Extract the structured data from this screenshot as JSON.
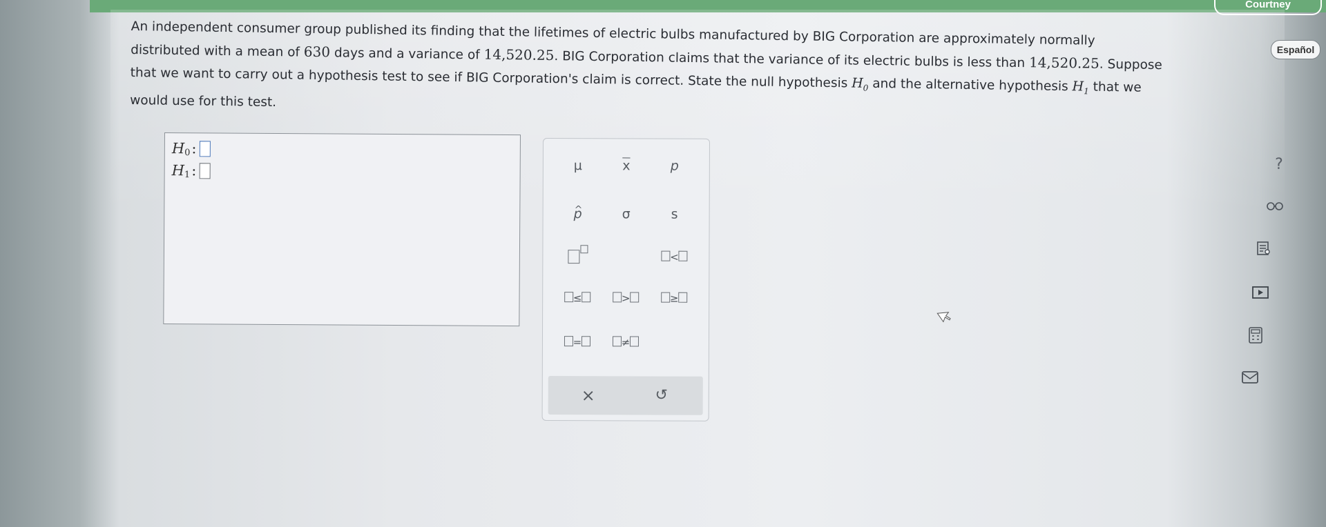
{
  "header": {
    "account_label": "Courtney",
    "language_button": "Español"
  },
  "question": {
    "line1": "An independent consumer group published its finding that the lifetimes of electric bulbs manufactured by BIG Corporation are approximately normally",
    "line2_a": "distributed with a mean of ",
    "mean": "630",
    "line2_b": " days and a variance of ",
    "variance": "14,520.25",
    "line2_c": ". BIG Corporation claims that the variance of its electric bulbs is less than ",
    "claim_variance": "14,520.25",
    "line2_d": ". Suppose",
    "line3_a": "that we want to carry out a hypothesis test to see if BIG Corporation's claim is correct. State the null hypothesis ",
    "null_symbol": "H",
    "null_sub": "0",
    "line3_b": " and the alternative hypothesis ",
    "alt_symbol": "H",
    "alt_sub": "1",
    "line3_c": " that we",
    "line4": "would use for this test."
  },
  "answer": {
    "h0_label": "H",
    "h0_sub": "0",
    "h0_colon": ":",
    "h1_label": "H",
    "h1_sub": "1",
    "h1_colon": ":"
  },
  "palette": {
    "mu": "μ",
    "xbar": "x",
    "p": "p",
    "phat": "p",
    "sigma": "σ",
    "s": "s",
    "lt": "<",
    "le": "≤",
    "gt": ">",
    "ge": "≥",
    "eq": "=",
    "ne": "≠",
    "clear": "×",
    "undo": "↺"
  },
  "sidebar": {
    "help": "?",
    "glasses_icon": "glasses-icon",
    "textbook_icon": "textbook-icon",
    "video_icon": "video-icon",
    "calculator_icon": "calculator-icon",
    "message_icon": "message-icon"
  }
}
